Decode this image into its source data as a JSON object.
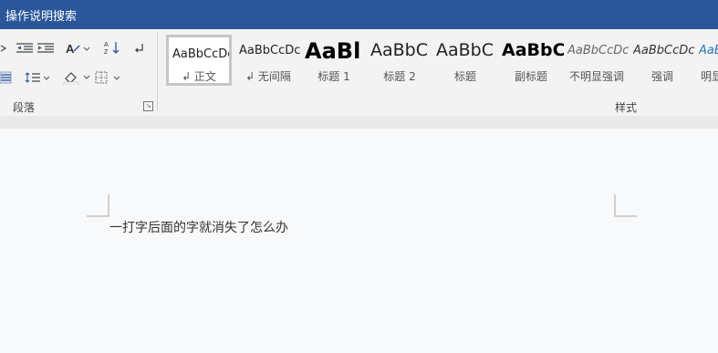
{
  "titlebar": {
    "title": "操作说明搜索",
    "bg": "#2b579a"
  },
  "ribbon": {
    "paragraph_group": {
      "label": "段落",
      "icons": [
        "decrease-indent-icon",
        "increase-indent-icon",
        "text-direction-icon",
        "sort-icon",
        "show-marks-icon",
        "justify-icon",
        "line-spacing-icon",
        "shading-icon",
        "borders-icon"
      ]
    },
    "styles_group": {
      "label": "样式",
      "items": [
        {
          "preview": "AaBbCcDc",
          "label": "↲ 正文",
          "selected": true
        },
        {
          "preview": "AaBbCcDc",
          "label": "↲ 无间隔"
        },
        {
          "preview": "AaBl",
          "label": "标题 1"
        },
        {
          "preview": "AaBbC",
          "label": "标题 2"
        },
        {
          "preview": "AaBbC",
          "label": "标题"
        },
        {
          "preview": "AaBbC",
          "label": "副标题"
        },
        {
          "preview": "AaBbCcDc",
          "label": "不明显强调"
        },
        {
          "preview": "AaBbCcDc",
          "label": "强调"
        },
        {
          "preview": "AaBb",
          "label": "明显"
        }
      ]
    }
  },
  "document": {
    "text": "一打字后面的字就消失了怎么办"
  }
}
